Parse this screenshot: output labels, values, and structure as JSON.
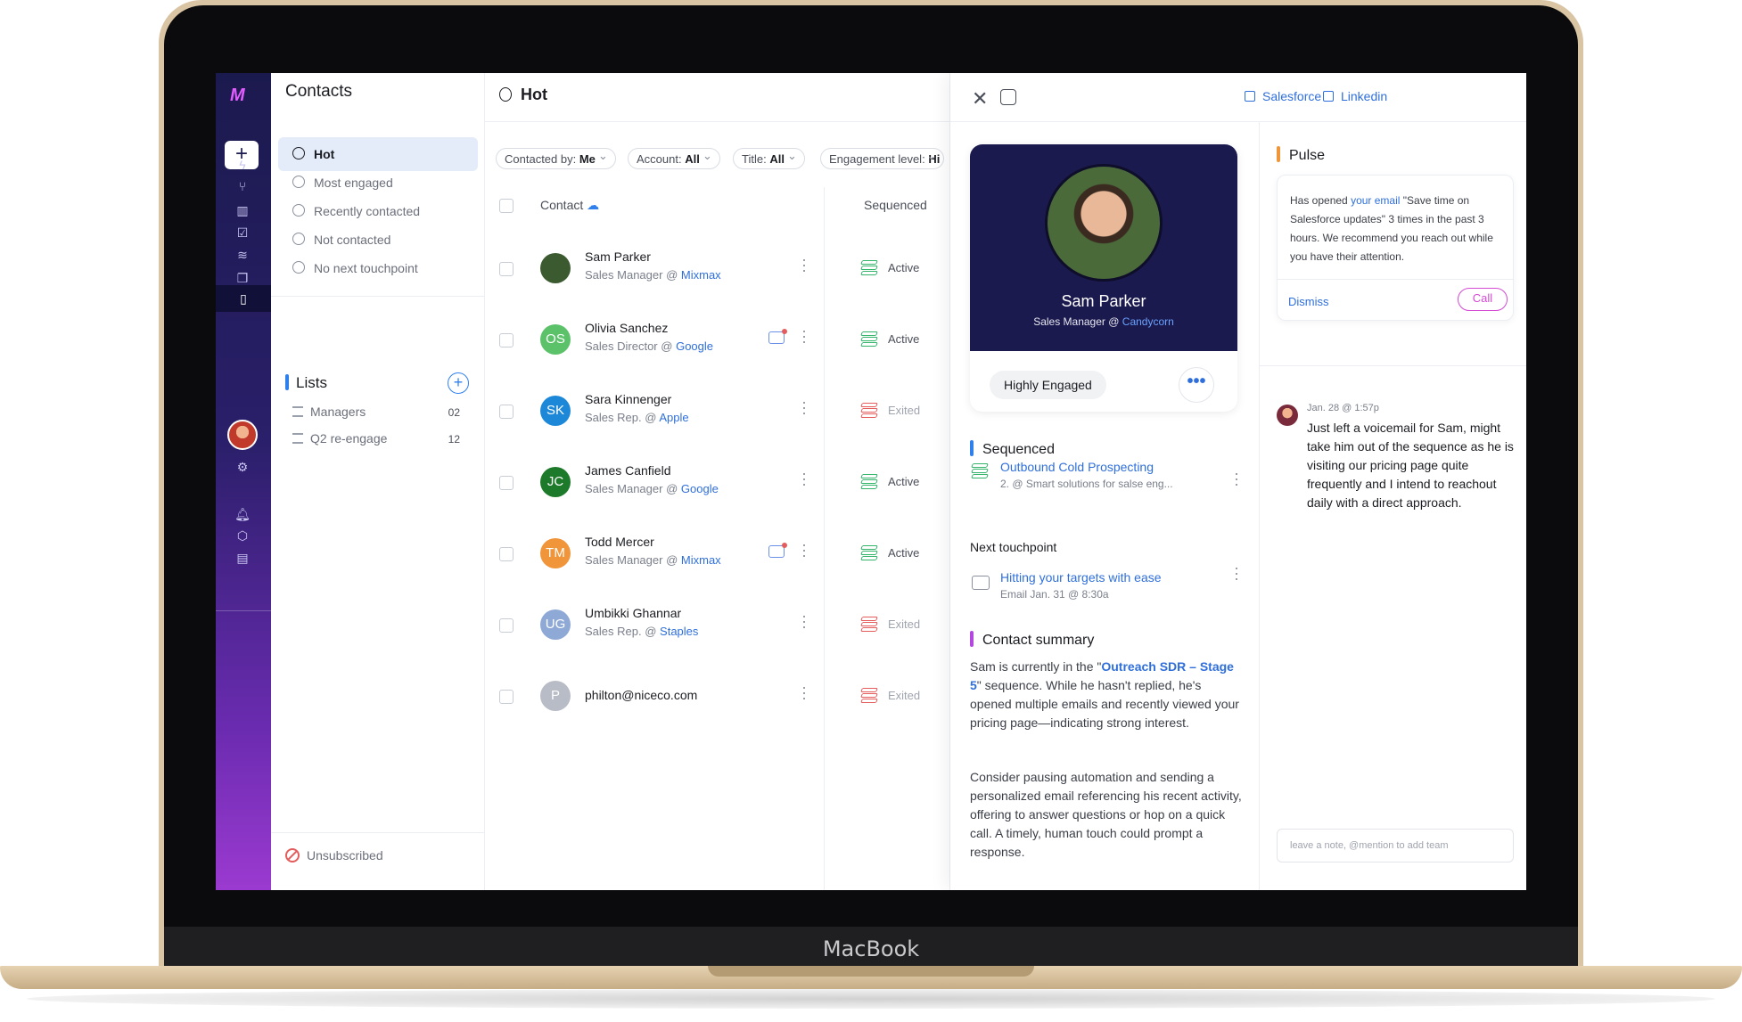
{
  "device": {
    "brand": "MacBook"
  },
  "rail": {
    "logo": "M",
    "items": [
      "lightning-icon",
      "branch-icon",
      "bar-chart-icon",
      "task-icon",
      "layers-icon",
      "copy-icon",
      "contacts-icon",
      "settings-icon",
      "bell-icon",
      "graduation-icon",
      "book-icon"
    ]
  },
  "lists_panel": {
    "title": "Contacts",
    "views": [
      {
        "label": "Hot",
        "selected": true
      },
      {
        "label": "Most engaged"
      },
      {
        "label": "Recently contacted"
      },
      {
        "label": "Not contacted"
      },
      {
        "label": "No next touchpoint"
      }
    ],
    "lists_heading": "Lists",
    "lists": [
      {
        "label": "Managers",
        "count": "02"
      },
      {
        "label": "Q2 re-engage",
        "count": "12"
      }
    ],
    "unsubscribed": "Unsubscribed"
  },
  "table": {
    "title": "Hot",
    "filters": [
      {
        "label": "Contacted by:",
        "value": "Me"
      },
      {
        "label": "Account:",
        "value": "All"
      },
      {
        "label": "Title:",
        "value": "All"
      },
      {
        "label": "Engagement level:",
        "value": "Hi"
      }
    ],
    "columns": {
      "contact": "Contact",
      "sequenced": "Sequenced"
    },
    "rows": [
      {
        "name": "Sam Parker",
        "role": "Sales Manager",
        "at": "@",
        "company": "Mixmax",
        "status": "Active",
        "initials": "",
        "avatar_color": "#3b5a2f",
        "has_mail": false
      },
      {
        "name": "Olivia Sanchez",
        "role": "Sales Director",
        "at": "@",
        "company": "Google",
        "status": "Active",
        "initials": "OS",
        "avatar_color": "#5cc26a",
        "has_mail": true
      },
      {
        "name": "Sara Kinnenger",
        "role": "Sales Rep.",
        "at": "@",
        "company": "Apple",
        "status": "Exited",
        "initials": "SK",
        "avatar_color": "#1e88d8",
        "has_mail": false
      },
      {
        "name": "James Canfield",
        "role": "Sales Manager",
        "at": "@",
        "company": "Google",
        "status": "Active",
        "initials": "JC",
        "avatar_color": "#1e7a2b",
        "has_mail": false
      },
      {
        "name": "Todd Mercer",
        "role": "Sales Manager",
        "at": "@",
        "company": "Mixmax",
        "status": "Active",
        "initials": "TM",
        "avatar_color": "#f0953a",
        "has_mail": true
      },
      {
        "name": "Umbikki Ghannar",
        "role": "Sales Rep.",
        "at": "@",
        "company": "Staples",
        "status": "Exited",
        "initials": "UG",
        "avatar_color": "#8fa9d6",
        "has_mail": false
      },
      {
        "name": "philton@niceco.com",
        "role": "",
        "at": "",
        "company": "",
        "status": "Exited",
        "initials": "P",
        "avatar_color": "#b8bcc6",
        "has_mail": false
      }
    ]
  },
  "detail": {
    "links": [
      "Salesforce",
      "Linkedin"
    ],
    "profile": {
      "name": "Sam Parker",
      "role": "Sales Manager",
      "at": "@",
      "company": "Candycorn",
      "badge": "Highly Engaged",
      "more": "•••"
    },
    "sequenced": {
      "heading": "Sequenced",
      "name": "Outbound Cold Prospecting",
      "sub": "2. @ Smart solutions for salse eng..."
    },
    "touchpoint": {
      "heading": "Next touchpoint",
      "name": "Hitting your targets with ease",
      "sub": "Email  Jan. 31 @ 8:30a"
    },
    "summary": {
      "heading": "Contact summary",
      "p1_a": "Sam is currently in the \"",
      "p1_link": "Outreach SDR – Stage 5",
      "p1_b": "\" sequence. While he hasn't replied, he's opened multiple emails and recently viewed your pricing page—indicating strong interest.",
      "p2": "Consider pausing automation and sending a personalized email referencing his recent activity, offering to answer questions or hop on a quick call. A timely, human touch could prompt a response."
    },
    "pulse": {
      "heading": "Pulse",
      "text_a": "Has opened ",
      "text_link": "your email",
      "text_b": " \"Save time on Salesforce updates\" 3 times in the past 3 hours. We recommend you reach out while you have their attention.",
      "dismiss": "Dismiss",
      "call": "Call"
    },
    "note": {
      "meta": "Jan. 28 @ 1:57p",
      "text": "Just left a voicemail for Sam, might take him out of the sequence as he is visiting our pricing page quite frequently and I intend to reachout daily with a direct approach."
    },
    "note_placeholder": "leave a note, @mention to add team"
  },
  "colors": {
    "accent": "#2f6fdc",
    "rail_top": "#1b1a4e",
    "rail_bottom": "#9b3ad0",
    "active_green": "#34b36b",
    "exited_red": "#e55c5c",
    "pulse_orange": "#f0953a",
    "summary_purple": "#b347e0"
  }
}
